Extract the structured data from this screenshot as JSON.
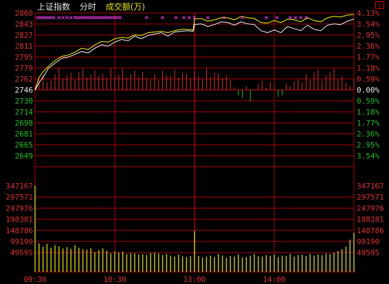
{
  "header": {
    "index_name": "上证指数",
    "view_mode": "分时",
    "volume_label": "成交额(万)"
  },
  "colors": {
    "background": "#000000",
    "grid": "#b00000",
    "price_line": "#ffffff",
    "avg_line": "#ffff00",
    "up": "#e03030",
    "down": "#20c020",
    "marker": "#ff40ff",
    "volume": "#d8d000",
    "neutral": "#e8e8e8"
  },
  "chart_data": [
    {
      "type": "line",
      "title": "上证指数 分时",
      "y_ticks_left": [
        "2860",
        "2843",
        "2827",
        "2811",
        "2795",
        "2779",
        "2762",
        "2746",
        "2730",
        "2714",
        "2698",
        "2681",
        "2665",
        "2649"
      ],
      "y_ticks_right": [
        "4.13%",
        "3.54%",
        "2.95%",
        "2.36%",
        "1.77%",
        "1.18%",
        "0.59%",
        "0.00%",
        "0.59%",
        "1.18%",
        "1.77%",
        "2.36%",
        "2.95%",
        "3.54%"
      ],
      "x_ticks": [
        "09:30",
        "10:30",
        "13:00",
        "14:00"
      ],
      "ylim": [
        2633,
        2860
      ],
      "prev_close": 2746,
      "series": [
        {
          "name": "price",
          "x": [
            0,
            3,
            6,
            10,
            15,
            20,
            25,
            30,
            35,
            40,
            45,
            50,
            55,
            60,
            65,
            70,
            75,
            80,
            85,
            90,
            95,
            100,
            105,
            110,
            115,
            119,
            120,
            125,
            130,
            135,
            140,
            145,
            150,
            155,
            160,
            165,
            170,
            175,
            180,
            185,
            190,
            195,
            200,
            205,
            210,
            215,
            220,
            225,
            230,
            235,
            240
          ],
          "values": [
            2746,
            2757,
            2765,
            2778,
            2786,
            2793,
            2795,
            2799,
            2803,
            2801,
            2808,
            2813,
            2811,
            2817,
            2821,
            2819,
            2826,
            2822,
            2827,
            2829,
            2831,
            2826,
            2832,
            2833,
            2834,
            2833,
            2843,
            2844,
            2840,
            2843,
            2847,
            2846,
            2842,
            2847,
            2844,
            2843,
            2834,
            2831,
            2835,
            2831,
            2840,
            2837,
            2834,
            2842,
            2836,
            2834,
            2842,
            2844,
            2843,
            2848,
            2851
          ]
        },
        {
          "name": "average",
          "x": [
            0,
            3,
            6,
            10,
            15,
            20,
            25,
            30,
            35,
            40,
            45,
            50,
            55,
            60,
            65,
            70,
            75,
            80,
            85,
            90,
            95,
            100,
            105,
            110,
            115,
            119,
            120,
            125,
            130,
            135,
            140,
            145,
            150,
            155,
            160,
            165,
            170,
            175,
            180,
            185,
            190,
            195,
            200,
            205,
            210,
            215,
            220,
            225,
            230,
            235,
            240
          ],
          "values": [
            2746,
            2765,
            2773,
            2781,
            2790,
            2796,
            2798,
            2802,
            2808,
            2806,
            2813,
            2818,
            2817,
            2822,
            2824,
            2823,
            2828,
            2827,
            2831,
            2832,
            2833,
            2831,
            2834,
            2836,
            2836,
            2835,
            2851,
            2852,
            2848,
            2850,
            2853,
            2853,
            2850,
            2855,
            2853,
            2852,
            2846,
            2845,
            2849,
            2846,
            2851,
            2850,
            2847,
            2853,
            2849,
            2847,
            2853,
            2855,
            2854,
            2857,
            2858
          ]
        },
        {
          "name": "breadth",
          "x": [
            0,
            3,
            6,
            9,
            12,
            15,
            18,
            21,
            24,
            27,
            30,
            33,
            36,
            39,
            42,
            45,
            48,
            51,
            54,
            57,
            60,
            63,
            66,
            69,
            72,
            75,
            78,
            81,
            84,
            87,
            90,
            93,
            96,
            99,
            102,
            105,
            108,
            111,
            114,
            117,
            120,
            123,
            126,
            129,
            132,
            135,
            138,
            141,
            144,
            147,
            150,
            153,
            156,
            159,
            162,
            165,
            168,
            171,
            174,
            177,
            180,
            183,
            186,
            189,
            192,
            195,
            198,
            201,
            204,
            207,
            210,
            213,
            216,
            219,
            222,
            225,
            228,
            231,
            234,
            237,
            240
          ],
          "values": [
            2755,
            2761,
            2768,
            2758,
            2760,
            2770,
            2779,
            2763,
            2768,
            2772,
            2762,
            2773,
            2777,
            2765,
            2769,
            2776,
            2767,
            2771,
            2764,
            2778,
            2767,
            2769,
            2777,
            2765,
            2770,
            2775,
            2766,
            2773,
            2764,
            2762,
            2770,
            2761,
            2775,
            2768,
            2767,
            2776,
            2765,
            2772,
            2770,
            2764,
            2774,
            2767,
            2763,
            2778,
            2766,
            2772,
            2771,
            2764,
            2768,
            2761,
            2750,
            2738,
            2735,
            2752,
            2730,
            2745,
            2755,
            2760,
            2750,
            2758,
            2752,
            2736,
            2738,
            2756,
            2752,
            2759,
            2762,
            2757,
            2770,
            2761,
            2772,
            2776,
            2760,
            2768,
            2773,
            2778,
            2762,
            2767,
            2757,
            2752,
            2763
          ]
        },
        {
          "name": "volume",
          "x": [
            0,
            3,
            6,
            9,
            12,
            15,
            18,
            21,
            24,
            27,
            30,
            33,
            36,
            39,
            42,
            45,
            48,
            51,
            54,
            57,
            60,
            63,
            66,
            69,
            72,
            75,
            78,
            81,
            84,
            87,
            90,
            93,
            96,
            99,
            102,
            105,
            108,
            111,
            114,
            117,
            120,
            123,
            126,
            129,
            132,
            135,
            138,
            141,
            144,
            147,
            150,
            153,
            156,
            159,
            162,
            165,
            168,
            171,
            174,
            177,
            180,
            183,
            186,
            189,
            192,
            195,
            198,
            201,
            204,
            207,
            210,
            213,
            216,
            219,
            222,
            225,
            228,
            231,
            234,
            237,
            240
          ],
          "values": [
            347167,
            115000,
            102000,
            113000,
            98000,
            108000,
            103000,
            95000,
            100000,
            93000,
            108000,
            98000,
            92000,
            90000,
            96000,
            80000,
            88000,
            95000,
            85000,
            75000,
            82000,
            78000,
            82000,
            72000,
            76000,
            75000,
            70000,
            72000,
            68000,
            76000,
            78000,
            74000,
            68000,
            72000,
            66000,
            62000,
            70000,
            63000,
            60000,
            64000,
            165000,
            65000,
            58000,
            62000,
            66000,
            60000,
            72000,
            66000,
            58000,
            65000,
            62000,
            70000,
            58000,
            60000,
            66000,
            72000,
            64000,
            62000,
            68000,
            65000,
            70000,
            60000,
            66000,
            64000,
            72000,
            62000,
            68000,
            70000,
            65000,
            72000,
            66000,
            70000,
            68000,
            74000,
            72000,
            78000,
            84000,
            92000,
            102000,
            130000,
            158000
          ]
        }
      ]
    },
    {
      "type": "bar",
      "title": "成交额(万)",
      "y_ticks_left": [
        "347167",
        "297571",
        "247976",
        "198381",
        "148786",
        "99190",
        "49595"
      ],
      "ylim": [
        0,
        347167
      ]
    }
  ]
}
